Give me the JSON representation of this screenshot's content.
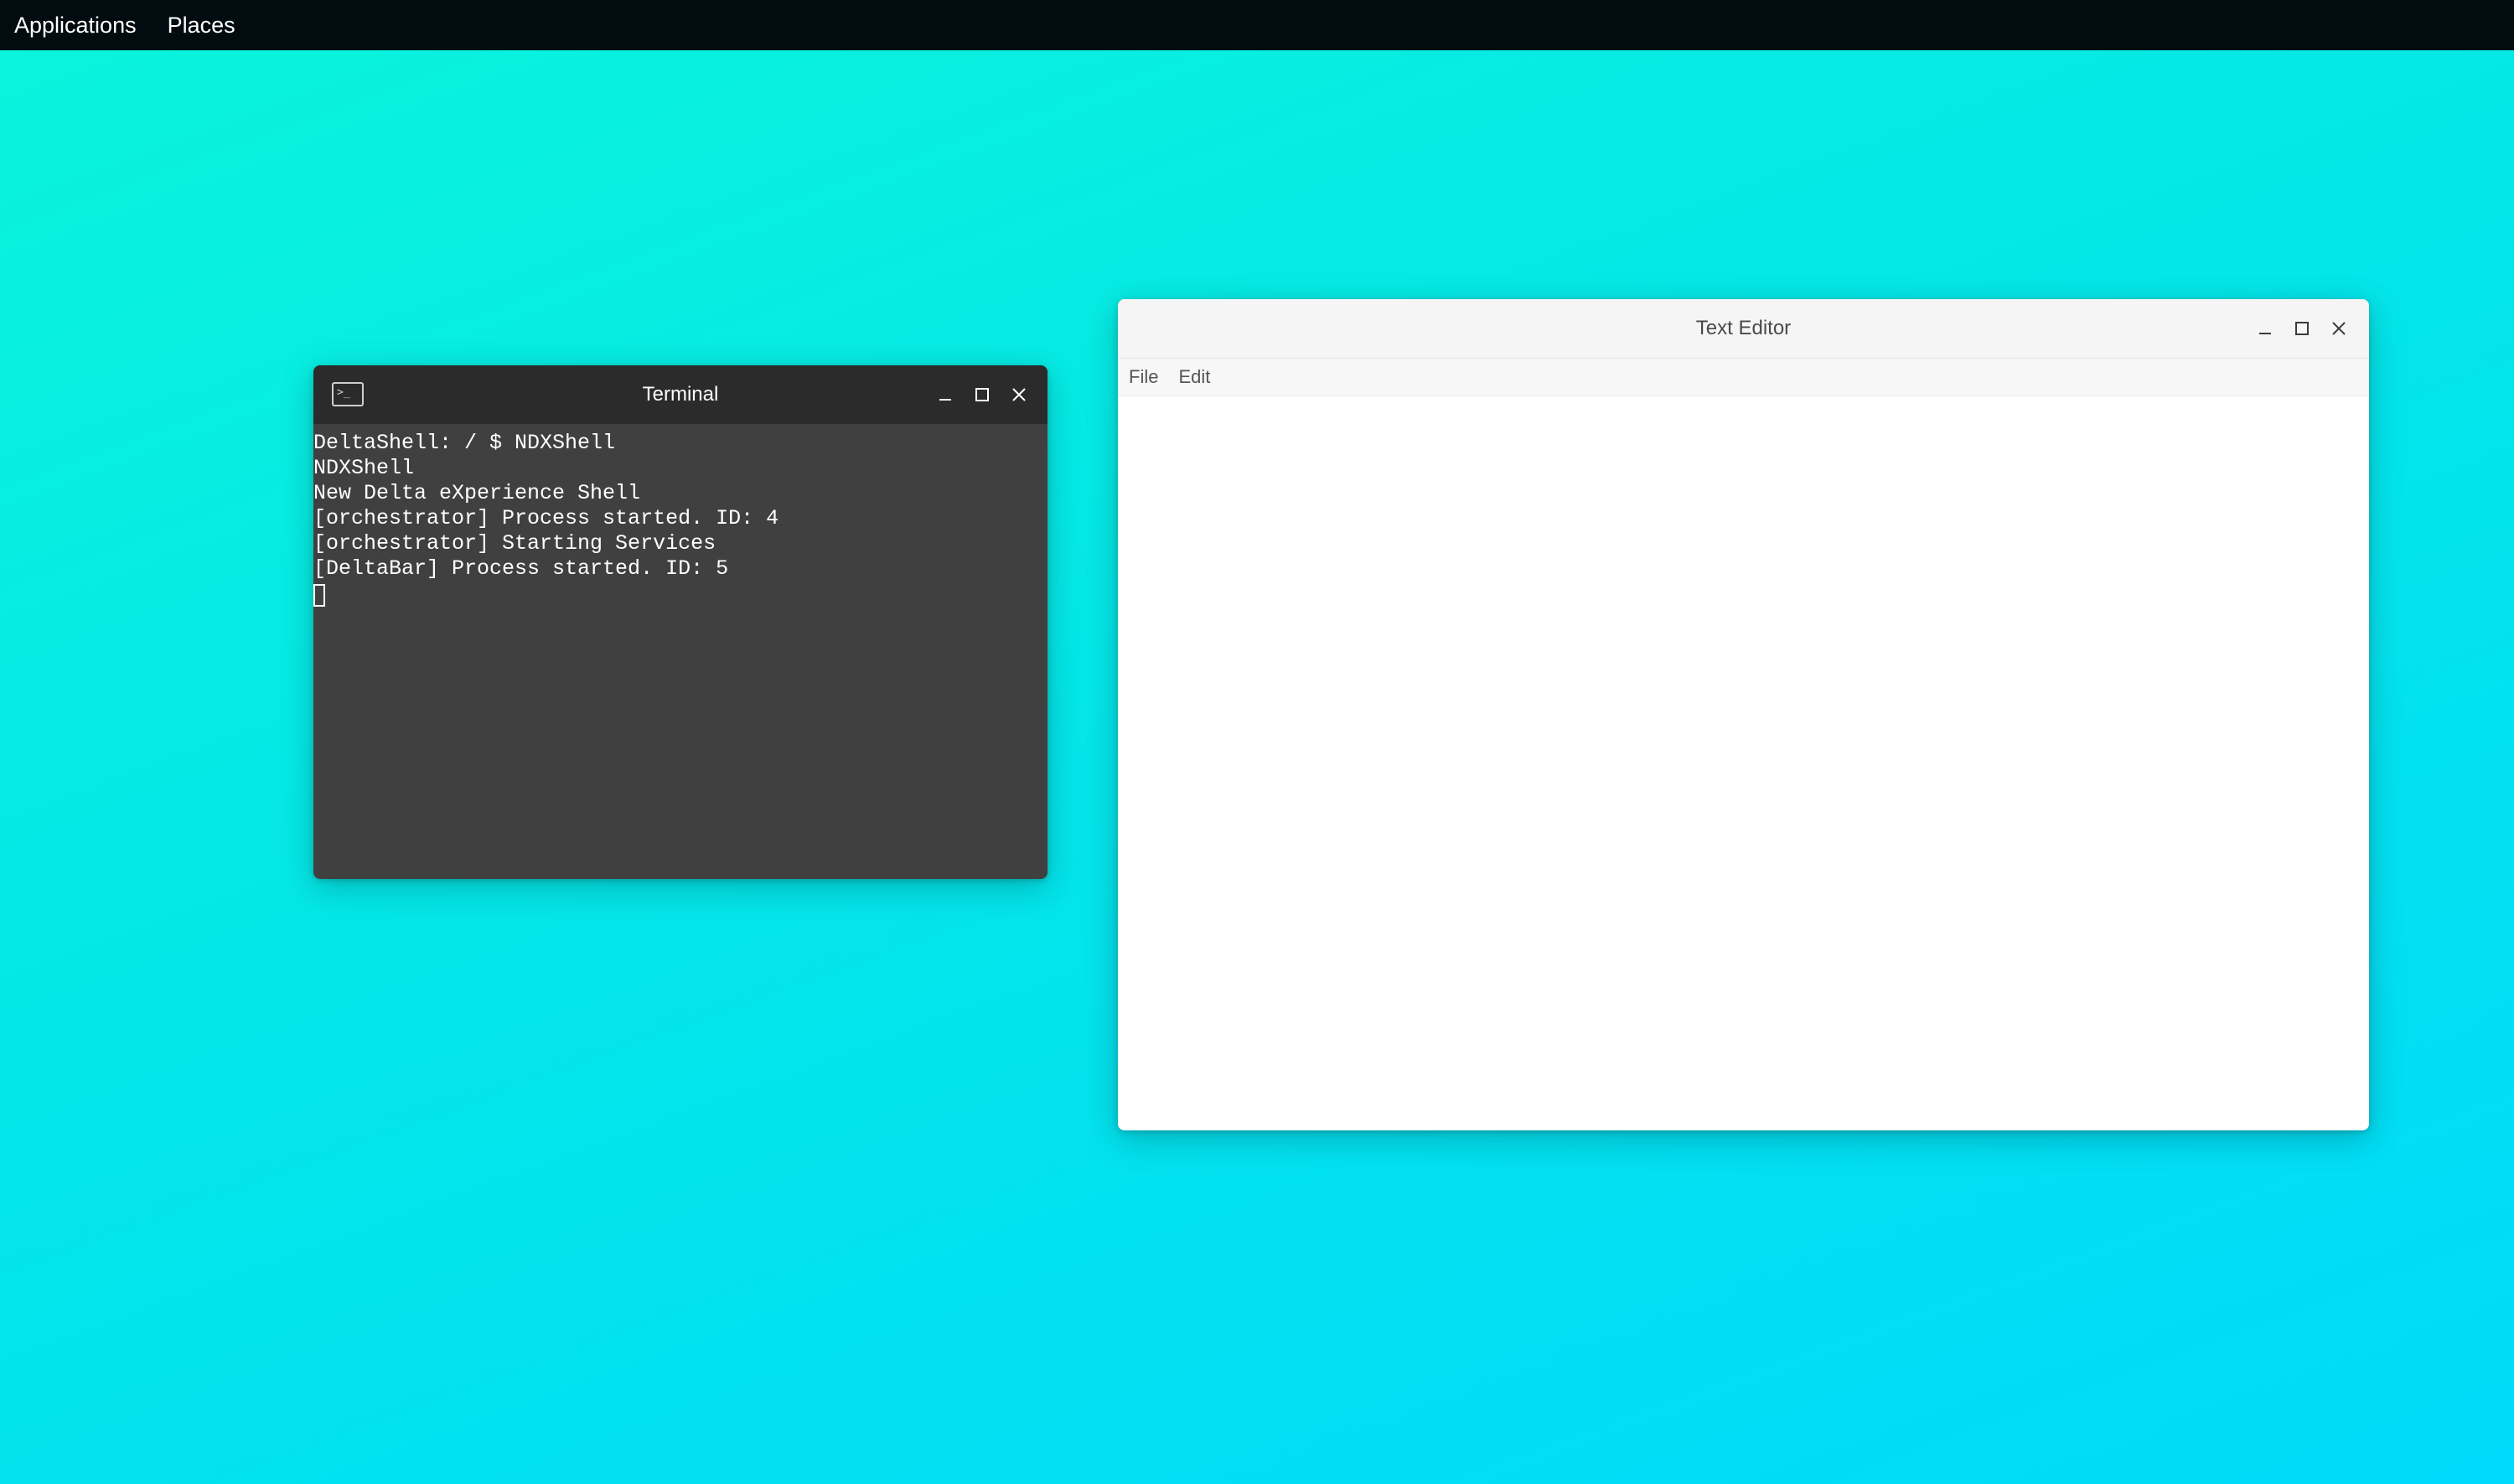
{
  "top_panel": {
    "applications_label": "Applications",
    "places_label": "Places"
  },
  "terminal": {
    "title": "Terminal",
    "icon": "terminal-icon",
    "icon_glyph": ">_",
    "lines": [
      "DeltaShell: / $ NDXShell",
      "NDXShell",
      "New Delta eXperience Shell",
      "[orchestrator] Process started. ID: 4",
      "[orchestrator] Starting Services",
      "[DeltaBar] Process started. ID: 5"
    ]
  },
  "editor": {
    "title": "Text Editor",
    "menu": {
      "file_label": "File",
      "edit_label": "Edit"
    },
    "content": ""
  },
  "colors": {
    "desktop_gradient": [
      "#0af4dc",
      "#00dafa"
    ],
    "top_panel": "#020c10",
    "terminal_bg": "#404040",
    "terminal_titlebar": "#2b2b2b",
    "editor_titlebar": "#f5f5f5"
  }
}
